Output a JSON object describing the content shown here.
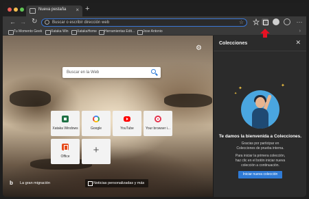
{
  "tab": {
    "title": "Nueva pestaña",
    "close": "×",
    "new": "+"
  },
  "toolbar": {
    "back": "←",
    "forward": "→",
    "reload": "↻",
    "address_placeholder": "Buscar o escribir dirección web",
    "star": "☆",
    "more": "···"
  },
  "bookmarks": {
    "items": [
      "Tu Momento Geek",
      "Xataka Win",
      "XatakaHome",
      "Herramientas Edit...",
      "Jose Antonio"
    ],
    "overflow": "›"
  },
  "newtab": {
    "settings": "⚙",
    "search_placeholder": "Buscar en la Web",
    "tiles": [
      {
        "label": "Xataka Windows",
        "icon": "excel-icon"
      },
      {
        "label": "Google",
        "icon": "google-icon"
      },
      {
        "label": "YouTube",
        "icon": "youtube-icon"
      },
      {
        "label": "Your browser i...",
        "icon": "cast-icon"
      },
      {
        "label": "Office",
        "icon": "office-icon"
      }
    ],
    "add_tile": "+",
    "bing_logo": "b",
    "footer_left": "La gran migración",
    "footer_right": "Noticias personalizadas y más"
  },
  "collections": {
    "title": "Colecciones",
    "close": "✕",
    "heading": "Te damos la bienvenida a Colecciones.",
    "para1": [
      "Gracias por participar en",
      "Colecciones de prueba interna."
    ],
    "para2": [
      "Para iniciar la primera colección,",
      "haz clic en el botón iniciar nueva",
      "colección a continuación."
    ],
    "start_button": "Iniciar nueva colección"
  },
  "colors": {
    "accent": "#2f7bd6",
    "highlight_arrow": "#e81123",
    "pane_bg": "#2b2b2b"
  }
}
